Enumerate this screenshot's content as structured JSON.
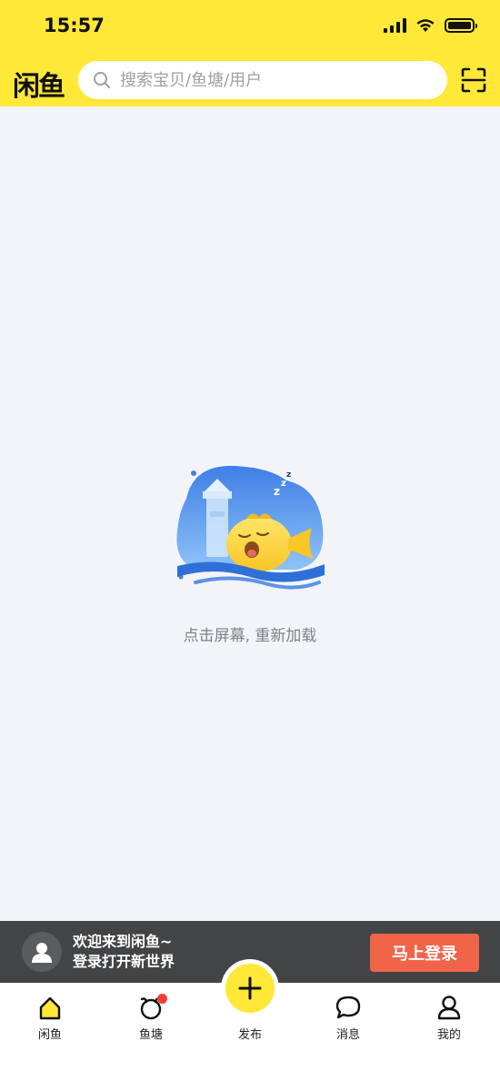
{
  "status_bar": {
    "time": "15:57"
  },
  "header": {
    "logo_text": "闲鱼",
    "search_placeholder": "搜索宝贝/鱼塘/用户",
    "scan_icon": "scan-icon"
  },
  "main": {
    "illustration": "sleeping-fish-illustration",
    "empty_text": "点击屏幕, 重新加载"
  },
  "login_bar": {
    "line1": "欢迎来到闲鱼~",
    "line2": "登录打开新世界",
    "button_label": "马上登录"
  },
  "tabbar": {
    "tabs": [
      {
        "label": "闲鱼",
        "icon": "home-icon",
        "active": true
      },
      {
        "label": "鱼塘",
        "icon": "fishpond-icon",
        "badge": true
      },
      {
        "label": "发布",
        "icon": "plus-icon"
      },
      {
        "label": "消息",
        "icon": "message-icon"
      },
      {
        "label": "我的",
        "icon": "profile-icon"
      }
    ]
  },
  "colors": {
    "brand_yellow": "#ffe838",
    "login_button": "#f0644a",
    "background": "#f3f4f8",
    "badge_red": "#ff3b30"
  }
}
